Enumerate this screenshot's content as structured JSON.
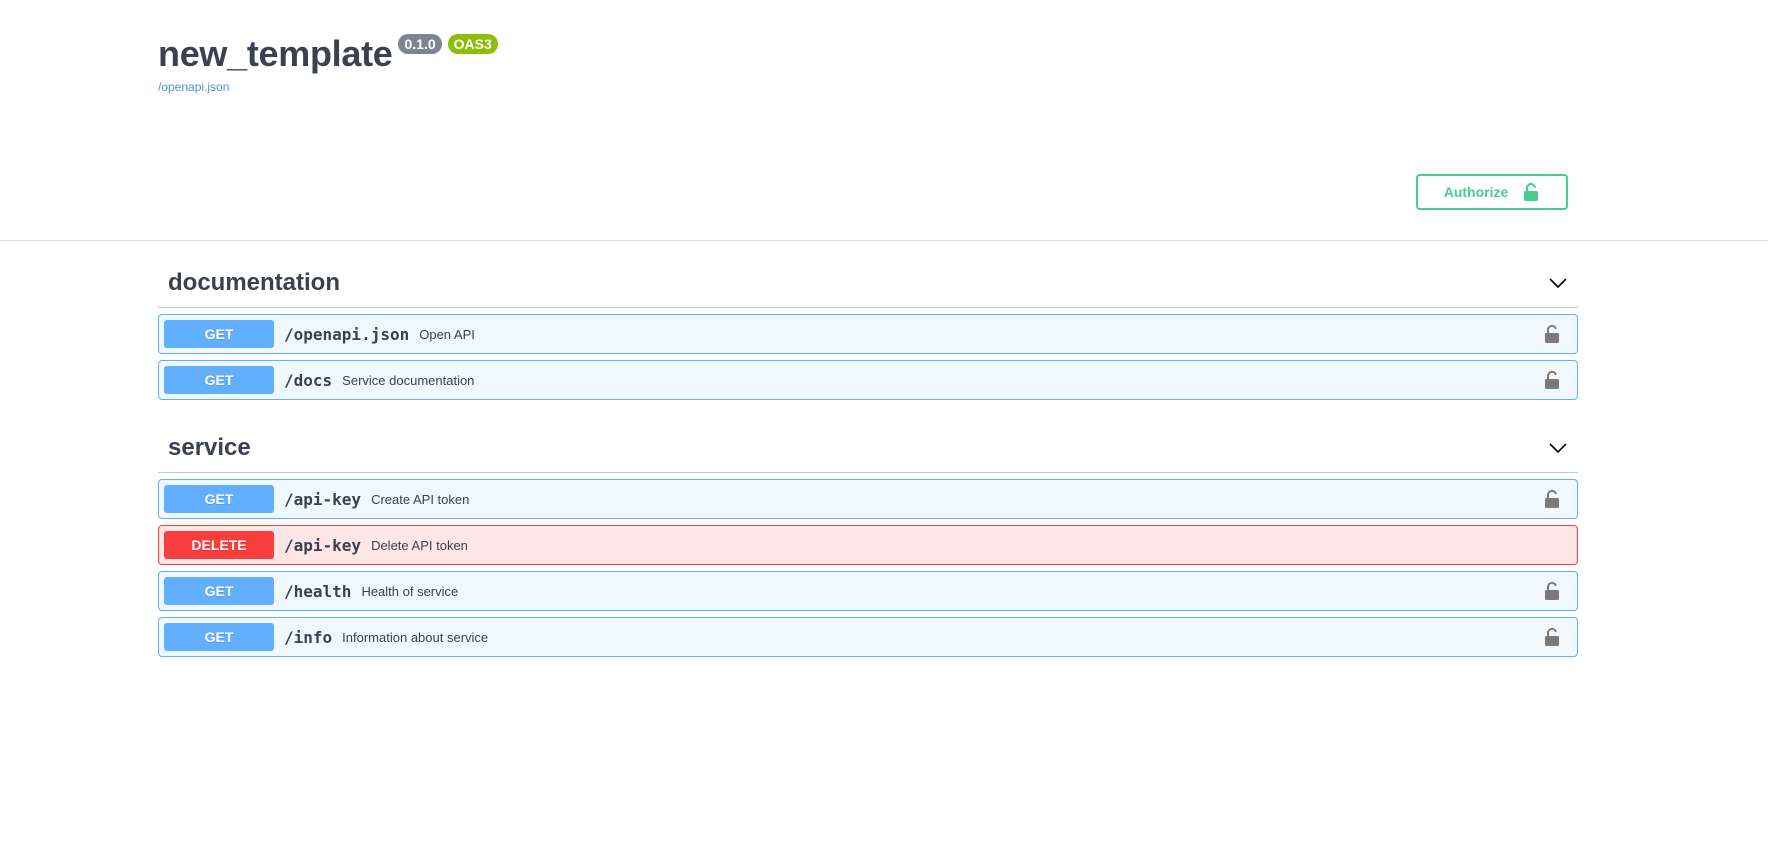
{
  "info": {
    "title": "new_template",
    "version": "0.1.0",
    "oas_badge": "OAS3",
    "spec_url": "/openapi.json"
  },
  "authorize": {
    "label": "Authorize",
    "icon": "unlocked-padlock-icon"
  },
  "colors": {
    "get": "#61affe",
    "delete": "#f93e3e",
    "authorize": "#49cc90",
    "version_badge": "#7d8492",
    "oas_badge": "#89bf04",
    "link": "#4990e2"
  },
  "tags": [
    {
      "name": "documentation",
      "operations": [
        {
          "method": "GET",
          "path": "/openapi.json",
          "summary": "Open API"
        },
        {
          "method": "GET",
          "path": "/docs",
          "summary": "Service documentation"
        }
      ]
    },
    {
      "name": "service",
      "operations": [
        {
          "method": "GET",
          "path": "/api-key",
          "summary": "Create API token"
        },
        {
          "method": "DELETE",
          "path": "/api-key",
          "summary": "Delete API token"
        },
        {
          "method": "GET",
          "path": "/health",
          "summary": "Health of service"
        },
        {
          "method": "GET",
          "path": "/info",
          "summary": "Information about service"
        }
      ]
    }
  ]
}
